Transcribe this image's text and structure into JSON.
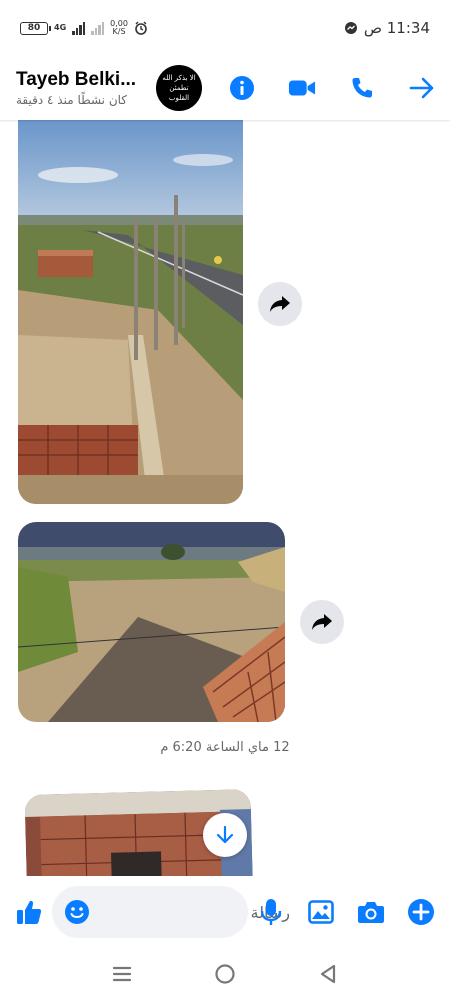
{
  "status_bar": {
    "battery": "80",
    "network": "4G",
    "speed_value": "0,00",
    "speed_unit": "K/S",
    "time": "11:34 ص"
  },
  "header": {
    "contact_name": "Tayeb Belki...",
    "active_status": "كان نشطًا منذ ٤ دقيقة",
    "avatar_text": "الا بذكر الله تطمئن القلوب",
    "icons": [
      "info-icon",
      "video-call-icon",
      "phone-icon",
      "forward-arrow-icon"
    ]
  },
  "thread": {
    "photos": [
      "photo-construction-site-road",
      "photo-field-shadow-bricks",
      "photo-brick-room"
    ],
    "timestamp": "12 ماي الساعة 6:20 م"
  },
  "composer": {
    "placeholder": "رسالة",
    "icons": [
      "like-icon",
      "emoji-icon",
      "microphone-icon",
      "gallery-icon",
      "camera-icon",
      "plus-icon"
    ]
  },
  "colors": {
    "accent": "#0a7cff",
    "icon_blue": "#1877f2",
    "bubble_gray": "#e4e6eb"
  }
}
